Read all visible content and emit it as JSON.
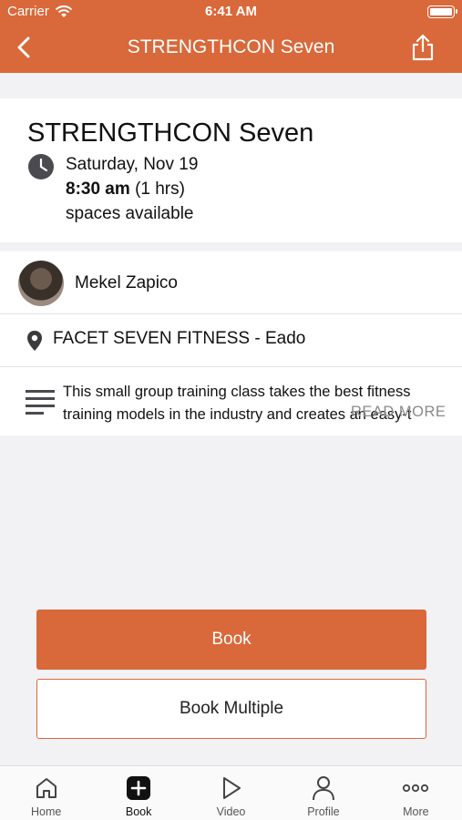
{
  "status_bar": {
    "carrier": "Carrier",
    "time": "6:41 AM"
  },
  "nav": {
    "title": "STRENGTHCON Seven",
    "back_icon": "chevron-left-icon",
    "share_icon": "share-icon"
  },
  "class_info": {
    "title": "STRENGTHCON Seven",
    "date": "Saturday, Nov 19",
    "time": "8:30 am",
    "duration": "(1 hrs)",
    "spaces": "spaces available"
  },
  "instructor": {
    "name": "Mekel Zapico"
  },
  "location": {
    "name": "FACET SEVEN FITNESS - Eado"
  },
  "description": {
    "text": "This small group training class takes the best fitness training models in the industry and creates an easy-t",
    "read_more": "READ MORE"
  },
  "actions": {
    "book": "Book",
    "book_multiple": "Book Multiple"
  },
  "tabbar": {
    "items": [
      {
        "label": "Home",
        "icon": "home-icon"
      },
      {
        "label": "Book",
        "icon": "plus-square-icon"
      },
      {
        "label": "Video",
        "icon": "play-icon"
      },
      {
        "label": "Profile",
        "icon": "person-icon"
      },
      {
        "label": "More",
        "icon": "more-icon"
      }
    ],
    "active": "Book"
  },
  "colors": {
    "accent": "#d9683a",
    "background": "#f2f2f4"
  }
}
